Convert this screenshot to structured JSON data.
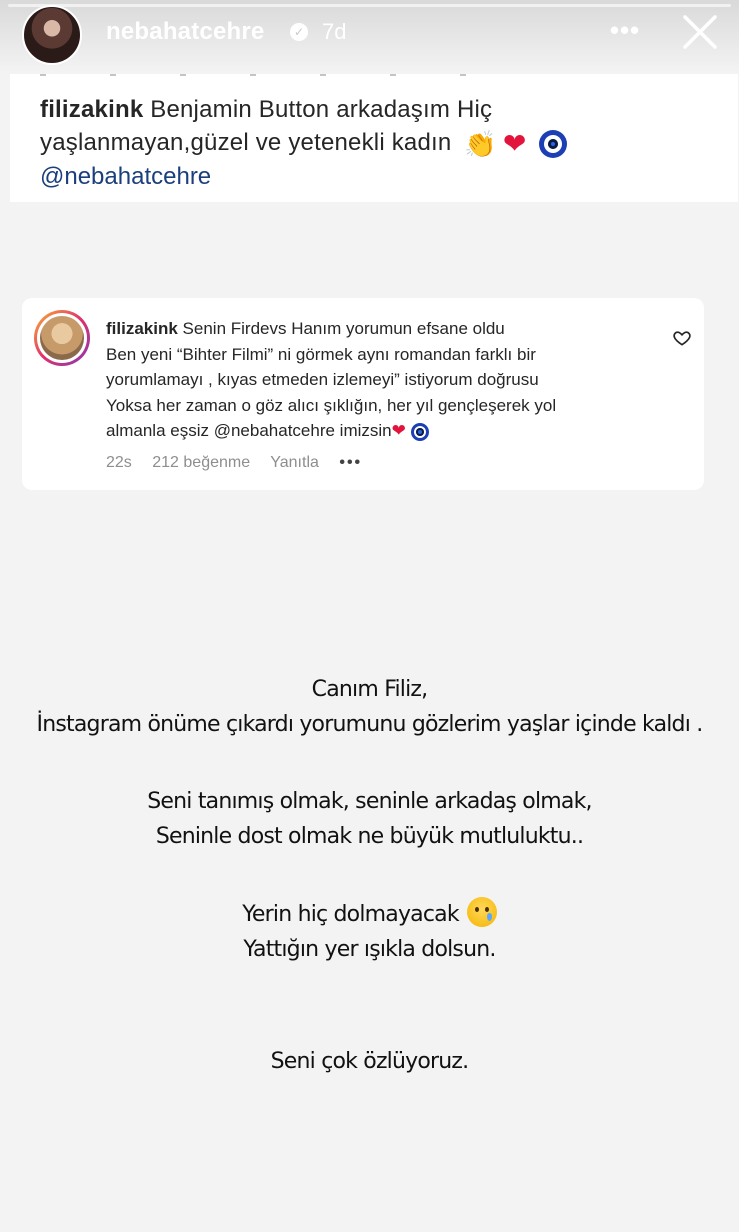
{
  "header": {
    "username": "nebahatcehre",
    "time_ago": "7d",
    "verified_icon": "verified-badge",
    "more_icon": "more-horizontal",
    "close_icon": "close-x"
  },
  "post": {
    "caption_user": "filizakink",
    "caption_line1": "Benjamin Button arkadaşım Hiç",
    "caption_line2": "yaşlanmayan,güzel ve yetenekli kadın",
    "emojis": [
      "clapping-hands",
      "red-heart",
      "nazar-amulet"
    ],
    "mention": "@nebahatcehre"
  },
  "comment": {
    "user": "filizakink",
    "lines": [
      "Senin Firdevs Hanım yorumun efsane oldu",
      "Ben yeni “Bihter Filmi” ni görmek aynı romandan farklı bir",
      "yorumlamayı , kıyas etmeden izlemeyi” istiyorum doğrusu",
      "Yoksa her zaman o göz alıcı şıklığın, her yıl gençleşerek yol",
      "almanla eşsiz @nebahatcehre imizsin"
    ],
    "time": "22s",
    "likes": "212 beğenme",
    "reply": "Yanıtla",
    "more": "•••",
    "like_icon": "heart-outline"
  },
  "message": {
    "line1": "Canım Filiz,",
    "line2": "İnstagram önüme çıkardı yorumunu gözlerim yaşlar içinde kaldı .",
    "line3": "Seni tanımış olmak, seninle arkadaş olmak,",
    "line4": "Seninle dost olmak ne büyük mutluluktu..",
    "line5": "Yerin hiç dolmayacak",
    "line5_emoji": "crying-face",
    "line6": "Yattığın yer ışıkla dolsun.",
    "line7": "Seni çok özlüyoruz."
  },
  "colors": {
    "background": "#f3f3f3",
    "card": "#ffffff",
    "text": "#262626",
    "muted": "#8e8e8e",
    "heart": "#e3143b",
    "mention": "#1b3f7c"
  }
}
